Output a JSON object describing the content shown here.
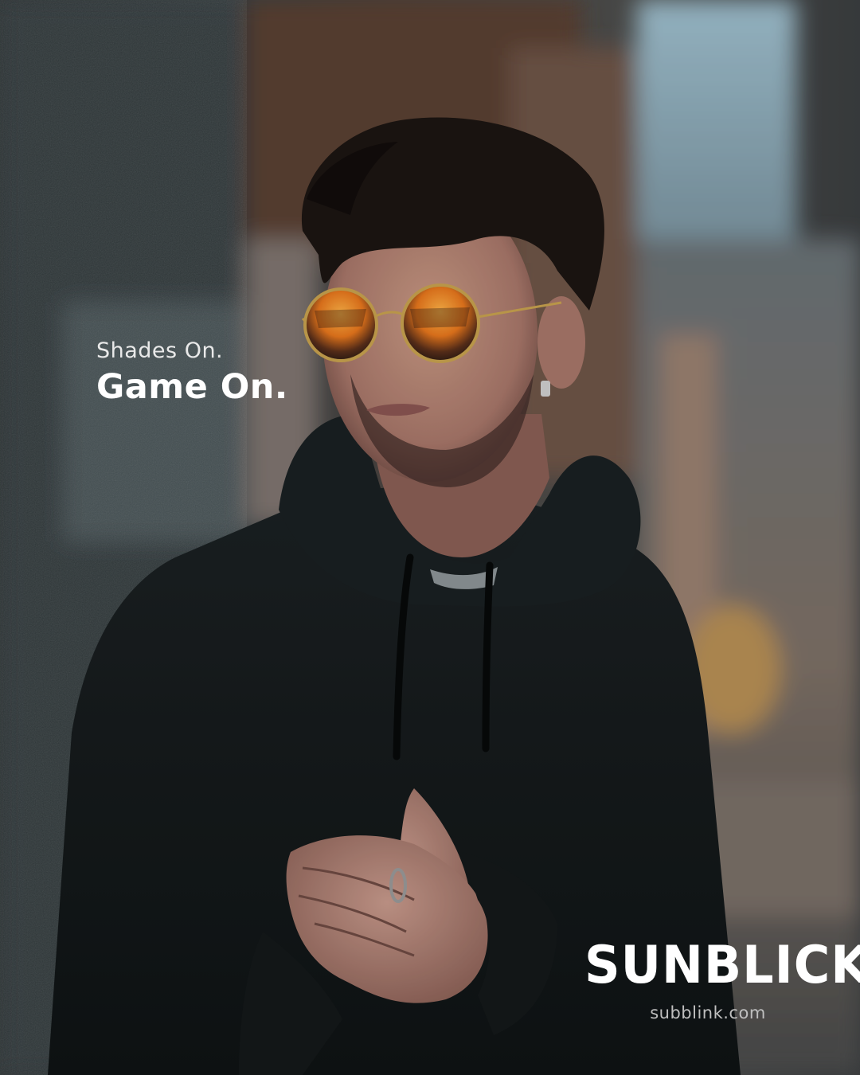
{
  "tagline": {
    "line1": "Shades On.",
    "line2": "Game On."
  },
  "brand": {
    "name": "SUNBLICK",
    "url": "subblink.com"
  },
  "colors": {
    "text_primary": "#ffffff",
    "text_secondary": "#e9e9e9",
    "url_text": "#bfbfbf",
    "hoodie": "#151a1c",
    "lens_orange": "#e8771d"
  },
  "photo": {
    "subject": "man-in-black-hoodie-with-orange-mirrored-round-sunglasses"
  }
}
